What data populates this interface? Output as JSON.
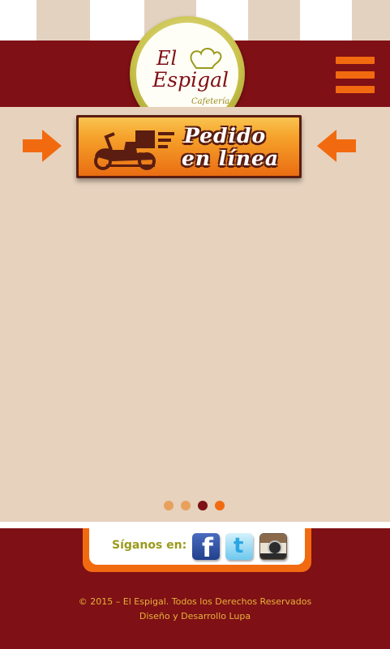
{
  "header": {
    "logo_line1": "El",
    "logo_line2": "Espigal",
    "logo_tagline": "Cafetería"
  },
  "banner": {
    "line1": "Pedido",
    "line2": "en línea"
  },
  "slider": {
    "dots": [
      {
        "color": "#e8a15c",
        "active": false
      },
      {
        "color": "#e8a15c",
        "active": false
      },
      {
        "color": "#7f1015",
        "active": true
      },
      {
        "color": "#f26a0f",
        "active": false
      }
    ]
  },
  "footer": {
    "follow_label": "Síganos en:",
    "social": [
      "facebook-icon",
      "twitter-icon",
      "instagram-icon"
    ],
    "copyright": "© 2015 – El Espigal. Todos los Derechos Reservados",
    "credits": "Diseño y Desarrollo Lupa"
  },
  "colors": {
    "brand_maroon": "#7f1015",
    "accent_orange": "#f26a0f",
    "slider_bg": "#e6d2bd",
    "footer_text": "#e8b33a"
  }
}
